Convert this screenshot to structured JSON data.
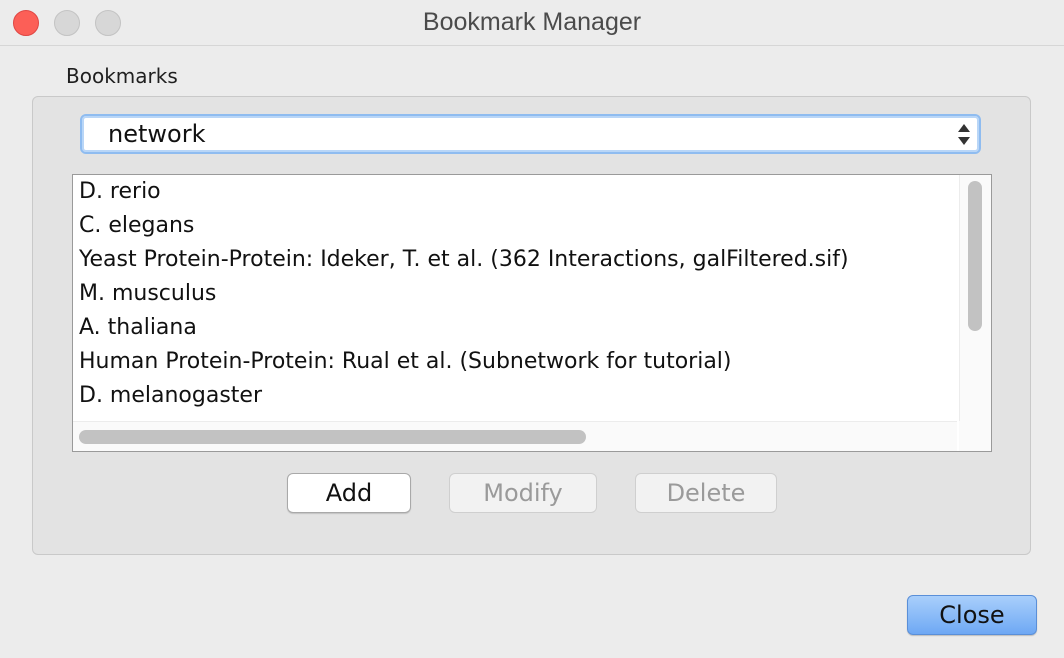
{
  "window": {
    "title": "Bookmark Manager"
  },
  "bookmarks": {
    "section_label": "Bookmarks",
    "category_selected": "network",
    "items": [
      "D. rerio",
      "C. elegans",
      "Yeast Protein-Protein: Ideker, T. et al. (362 Interactions, galFiltered.sif)",
      "M. musculus",
      "A. thaliana",
      "Human Protein-Protein: Rual et al. (Subnetwork for tutorial)",
      "D. melanogaster"
    ]
  },
  "actions": {
    "add_label": "Add",
    "modify_label": "Modify",
    "delete_label": "Delete",
    "close_label": "Close"
  },
  "icons": {
    "close_window": "close-window-icon",
    "minimize_window": "minimize-window-icon",
    "zoom_window": "zoom-window-icon",
    "combo_arrows": "up-down-arrows-icon"
  },
  "colors": {
    "close_traffic": "#fc5f57",
    "focus_ring": "#8fbcf0",
    "primary_button": "#6ea8f4"
  }
}
